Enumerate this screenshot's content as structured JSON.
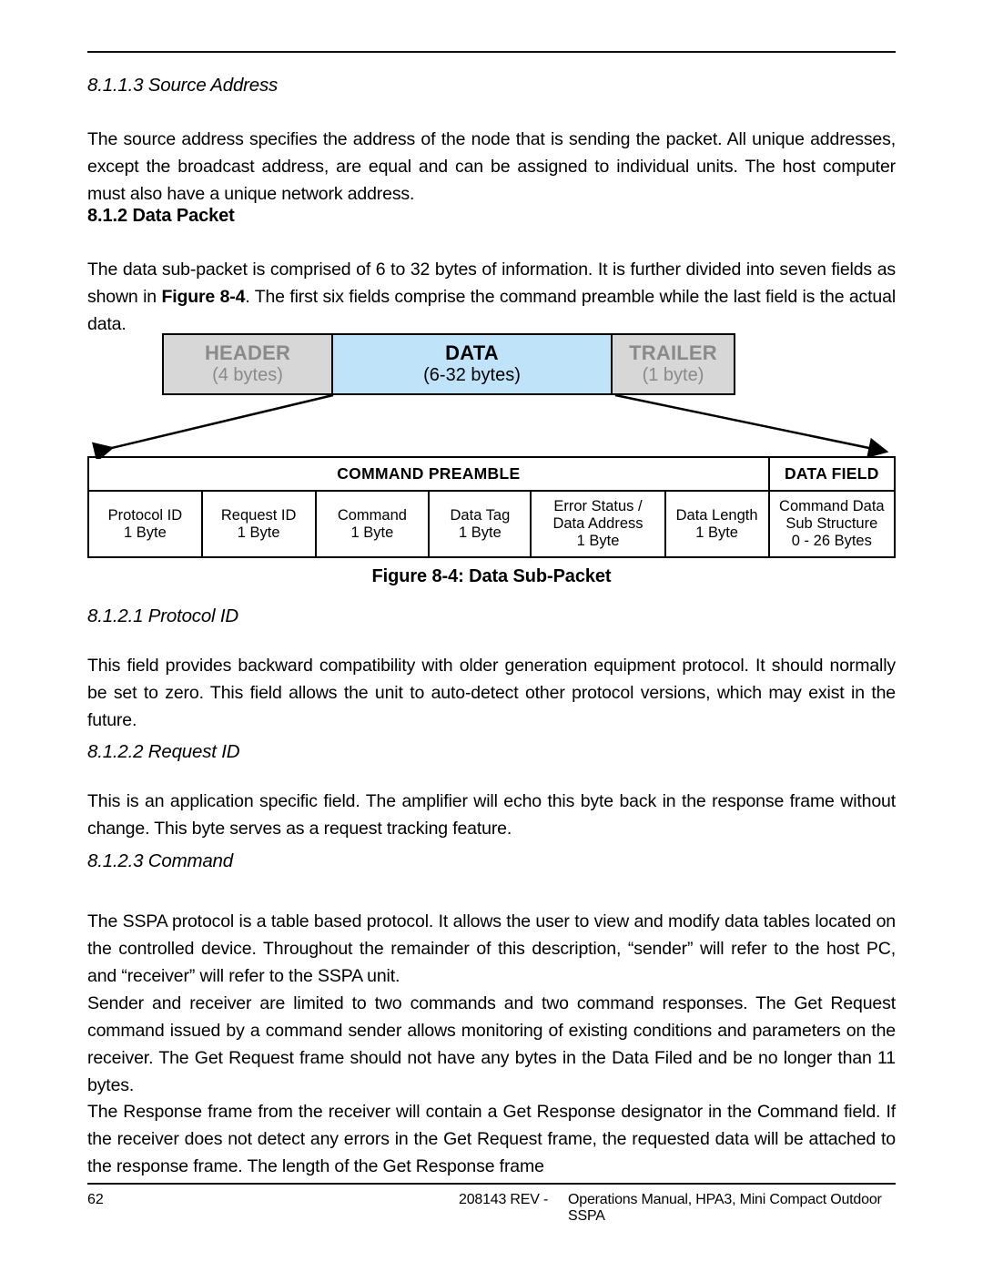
{
  "document": {
    "sections": [
      {
        "id": "source-address",
        "number_title": "8.1.1.3 Source Address",
        "style": "italic",
        "paragraphs": [
          "The source address specifies the address of the node that is sending the packet.  All unique addresses, except the broadcast address, are equal and can be assigned to individual units. The host computer must also have a unique network address."
        ]
      },
      {
        "id": "data-packet",
        "number_title": "8.1.2 Data Packet",
        "style": "bold",
        "paragraphs": [
          "The data sub-packet is comprised of 6 to 32 bytes of information. It is further divided into seven fields as shown in "
        ],
        "paragraph_bold_ref": "Figure 8-4",
        "paragraph_tail": ". The first six fields comprise the command preamble while the last field is the actual data."
      },
      {
        "id": "protocol-id",
        "number_title": "8.1.2.1 Protocol ID",
        "style": "italic",
        "paragraphs": [
          "This field provides backward compatibility with older generation equipment protocol. It should normally be set to zero. This field allows the unit to auto-detect other protocol versions, which may exist in the future."
        ]
      },
      {
        "id": "request-id",
        "number_title": "8.1.2.2 Request ID",
        "style": "italic",
        "paragraphs": [
          "This is an application specific field. The amplifier will echo this byte back in the response frame without change. This byte serves as a request tracking feature."
        ]
      },
      {
        "id": "command",
        "number_title": "8.1.2.3 Command",
        "style": "italic",
        "paragraphs": [
          "The SSPA protocol is a table based protocol. It allows the user to view and modify data tables located on the controlled device. Throughout the remainder of this description, “sender” will refer to the host PC, and “receiver” will refer to the SSPA unit.",
          "Sender and receiver are limited to two commands and two command responses. The Get Request command issued by a command sender allows monitoring of existing conditions and parameters on the receiver. The Get Request frame should not have any bytes in the Data Filed and be no longer than 11 bytes.",
          "The Response frame from the receiver will contain a Get Response designator in the Command field. If the receiver does not detect any errors in the Get Request frame, the requested data will be attached to the response frame. The length of the Get Response frame"
        ]
      }
    ]
  },
  "figure": {
    "caption": "Figure 8-4: Data Sub-Packet",
    "packet_blocks": [
      {
        "name": "HEADER",
        "size": "(4 bytes)",
        "fill": "#d7d7d7",
        "text_color": "#8a8a8a"
      },
      {
        "name": "DATA",
        "size": "(6-32 bytes)",
        "fill": "#bfe4fa",
        "text_color": "#000000"
      },
      {
        "name": "TRAILER",
        "size": "(1 byte)",
        "fill": "#d7d7d7",
        "text_color": "#8a8a8a"
      }
    ],
    "group_headers": [
      {
        "label": "COMMAND PREAMBLE",
        "span": 6
      },
      {
        "label": "DATA FIELD",
        "span": 1
      }
    ],
    "fields": [
      {
        "name": "Protocol ID",
        "size": "1 Byte"
      },
      {
        "name": "Request ID",
        "size": "1 Byte"
      },
      {
        "name": "Command",
        "size": "1 Byte"
      },
      {
        "name": "Data Tag",
        "size": "1 Byte"
      },
      {
        "name": "Error Status /",
        "name2": "Data Address",
        "size": "1 Byte"
      },
      {
        "name": "Data Length",
        "size": "1 Byte"
      },
      {
        "name": "Command Data",
        "name2": "Sub Structure",
        "size": "0 - 26 Bytes"
      }
    ]
  },
  "footer": {
    "page_number": "62",
    "revision": "208143 REV -",
    "document_title": "Operations Manual, HPA3, Mini Compact Outdoor SSPA"
  }
}
